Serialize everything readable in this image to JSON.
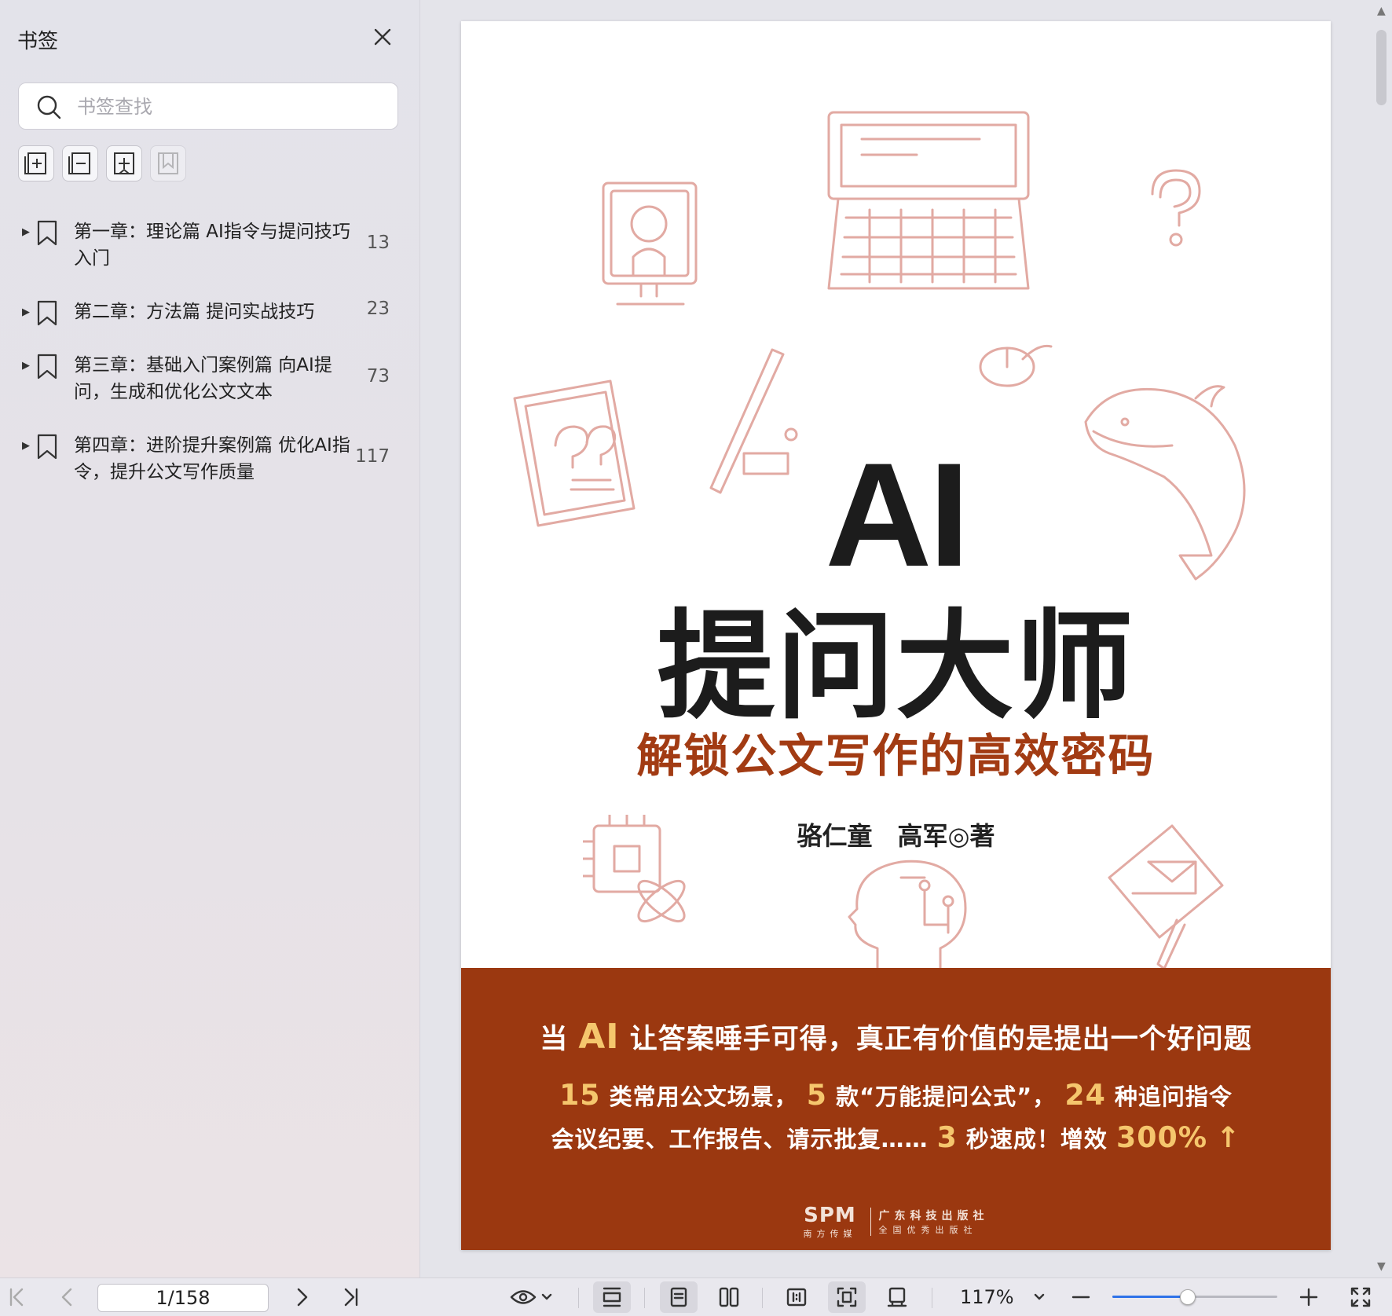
{
  "sidebar": {
    "title": "书签",
    "search_placeholder": "书签查找",
    "toolbar": [
      {
        "icon": "add-bookmark-icon"
      },
      {
        "icon": "remove-bookmark-icon"
      },
      {
        "icon": "add-child-bookmark-icon"
      },
      {
        "icon": "bookmark-disabled-icon"
      }
    ],
    "bookmarks": [
      {
        "label": "第一章：理论篇 AI指令与提问技巧入门",
        "page": "13"
      },
      {
        "label": "第二章：方法篇 提问实战技巧",
        "page": "23"
      },
      {
        "label": "第三章：基础入门案例篇 向AI提问，生成和优化公文文本",
        "page": "73"
      },
      {
        "label": "第四章：进阶提升案例篇 优化AI指令，提升公文写作质量",
        "page": "117"
      }
    ]
  },
  "cover": {
    "title_ai": "AI",
    "title_cn": "提问大师",
    "subtitle": "解锁公文写作的高效密码",
    "authors": "骆仁童　高军◎著",
    "band": {
      "line1_pre": "当",
      "line1_ai": "AI",
      "line1_post": "让答案唾手可得，真正有价值的是提出一个好问题",
      "line2_n1": "15",
      "line2_t1": "类常用公文场景，",
      "line2_n2": "5",
      "line2_t2": "款“万能提问公式”，",
      "line2_n3": "24",
      "line2_t3": "种追问指令",
      "line3_t1": "会议纪要、工作报告、请示批复……",
      "line3_n1": "3",
      "line3_t2": "秒速成！增效",
      "line3_n2": "300%",
      "line3_arrow": "↑"
    },
    "publisher": {
      "logo": "SPM",
      "logo_sub": "南方传媒",
      "name": "广东科技出版社",
      "tag": "全国优秀出版社"
    }
  },
  "bottombar": {
    "page_value": "1/158",
    "zoom": "117%",
    "zoom_fraction": 0.45
  },
  "colors": {
    "band": "#9b3810",
    "subtitle": "#a23b13",
    "highlight": "#f5c66d",
    "illustration": "#e2aaa3",
    "accent": "#2e72e8"
  }
}
